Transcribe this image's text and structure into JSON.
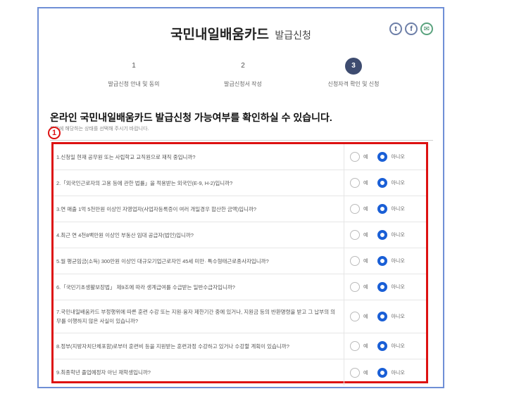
{
  "header": {
    "title": "국민내일배움카드",
    "subtitle": "발급신청",
    "share_icons": [
      {
        "name": "twitter-icon",
        "glyph": "t"
      },
      {
        "name": "facebook-icon",
        "glyph": "f"
      },
      {
        "name": "message-icon",
        "glyph": "✉"
      }
    ]
  },
  "steps": [
    {
      "num": "1",
      "label": "발급신청 안내 및 동의",
      "active": false
    },
    {
      "num": "2",
      "label": "발급신청서 작성",
      "active": false
    },
    {
      "num": "3",
      "label": "신청자격 확인 및 신청",
      "active": true
    }
  ],
  "headline": "온라인 국민내일배움카드 발급신청 가능여부를 확인하실 수 있습니다.",
  "subnote": "항목에 해당하는 상태를 선택해 주시기 바랍니다.",
  "marker": "1",
  "options": {
    "yes": "예",
    "no": "아니오"
  },
  "questions": [
    {
      "text": "1.신청일 현재 공무원 또는 사립학교 교직원으로 재직 중입니까?",
      "answer": "no"
    },
    {
      "text": "2.「외국인근로자의 고용 등에 관한 법률」을 적용받는 외국인(E-9, H-2)입니까?",
      "answer": "no"
    },
    {
      "text": "3.연 매출 1억 5천만원 이상인 자영업자(사업자등록증이 여러 개일경우 합산한 금액)입니까?",
      "answer": "no"
    },
    {
      "text": "4.최근 연 4천8백만원 이상인 부동산 임대 공급자(법인)입니까?",
      "answer": "no"
    },
    {
      "text": "5.월 평균임금(소득) 300만원 이상인 대규모기업근로자인 45세 미만· 특수형태근로종사자입니까?",
      "answer": "no"
    },
    {
      "text": "6.「국민기초생활보장법」 제9조에 따라 생계급여를 수급받는 일반수급자입니까?",
      "answer": "no"
    },
    {
      "text": "7.국민내일배움카드 부정행위에 따른 훈련 수강 또는 지원·융자 제한기간 중에 있거나, 지원금 등의 반환명령을 받고 그 납부의 의무를 이행하지 않은 사실이 있습니까?",
      "answer": "no"
    },
    {
      "text": "8.정부(지방자치단체포함)로부터 훈련비 등을 지원받는 훈련과정 수강하고 있거나 수강할 계획이 있습니까?",
      "answer": "no"
    },
    {
      "text": "9.최종학년 졸업예정자 아닌 재학생입니까?",
      "answer": "no"
    }
  ]
}
